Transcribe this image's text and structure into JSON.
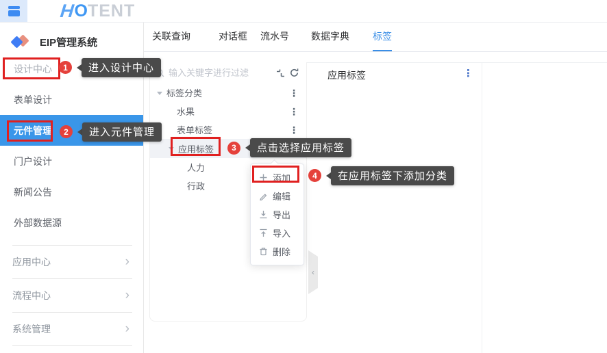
{
  "header": {
    "logo": {
      "h": "H",
      "o": "O",
      "rest": "TENT"
    }
  },
  "sidebar": {
    "title": "EIP管理系统",
    "items": [
      "设计中心",
      "表单设计",
      "元件管理",
      "门户设计",
      "新闻公告",
      "外部数据源"
    ],
    "groups": [
      "应用中心",
      "流程中心",
      "系统管理"
    ]
  },
  "tabs": [
    "关联查询",
    "对话框",
    "流水号",
    "数据字典",
    "标签"
  ],
  "tree_panel": {
    "search_placeholder": "输入关键字进行过滤",
    "root": "标签分类",
    "nodes": [
      "水果",
      "表单标签",
      "应用标签"
    ],
    "app_tag_children": [
      "人力",
      "行政"
    ]
  },
  "context_menu": {
    "items": [
      {
        "icon": "plus-icon",
        "label": "添加"
      },
      {
        "icon": "edit-icon",
        "label": "编辑"
      },
      {
        "icon": "export-icon",
        "label": "导出"
      },
      {
        "icon": "import-icon",
        "label": "导入"
      },
      {
        "icon": "delete-icon",
        "label": "删除"
      }
    ]
  },
  "right_panel": {
    "title": "应用标签"
  },
  "annotations": [
    {
      "num": "1",
      "tip": "进入设计中心"
    },
    {
      "num": "2",
      "tip": "进入元件管理"
    },
    {
      "num": "3",
      "tip": "点击选择应用标签"
    },
    {
      "num": "4",
      "tip": "在应用标签下添加分类"
    }
  ],
  "colors": {
    "accent_blue": "#3a96e9",
    "tab_active_blue": "#3a8ee6",
    "annotation_red": "#e02020",
    "badge_red": "#e5413b",
    "tooltip_bg": "#4a4a4a"
  }
}
